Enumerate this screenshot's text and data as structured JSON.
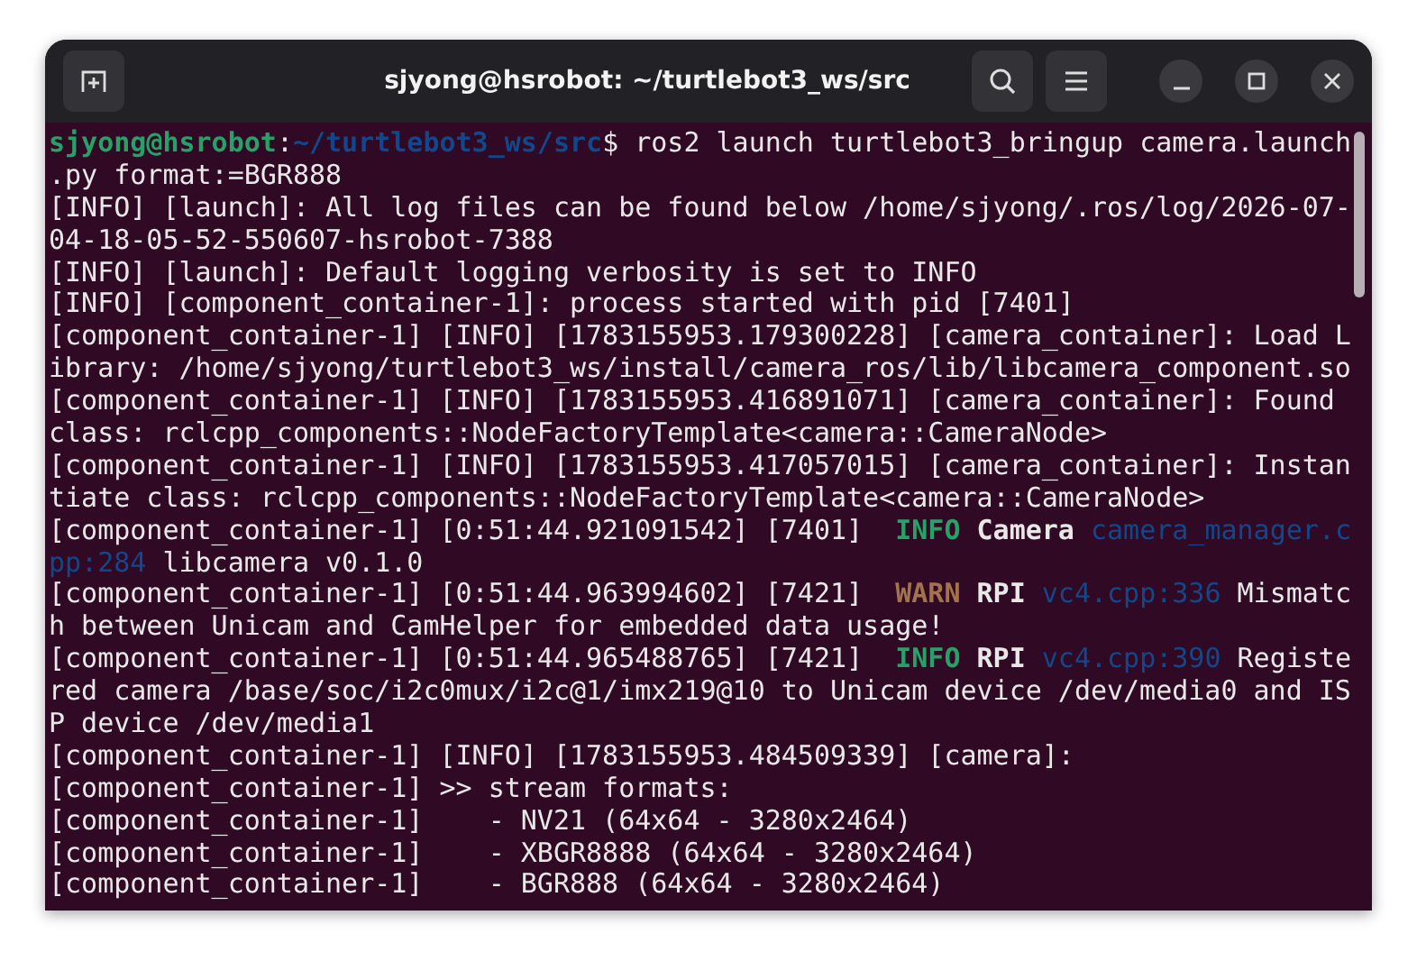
{
  "window": {
    "title": "sjyong@hsrobot: ~/turtlebot3_ws/src"
  },
  "terminal": {
    "lines": [
      {
        "segments": [
          {
            "kind": "user",
            "text": "sjyong@hsrobot"
          },
          {
            "kind": "plain",
            "text": ":"
          },
          {
            "kind": "path",
            "text": "~/turtlebot3_ws/src"
          },
          {
            "kind": "plain",
            "text": "$ ros2 launch turtlebot3_bringup camera.launch"
          }
        ]
      },
      {
        "segments": [
          {
            "kind": "plain",
            "text": ".py format:=BGR888"
          }
        ]
      },
      {
        "segments": [
          {
            "kind": "plain",
            "text": "[INFO] [launch]: All log files can be found below /home/sjyong/.ros/log/2026-07-"
          }
        ]
      },
      {
        "segments": [
          {
            "kind": "plain",
            "text": "04-18-05-52-550607-hsrobot-7388"
          }
        ]
      },
      {
        "segments": [
          {
            "kind": "plain",
            "text": "[INFO] [launch]: Default logging verbosity is set to INFO"
          }
        ]
      },
      {
        "segments": [
          {
            "kind": "plain",
            "text": "[INFO] [component_container-1]: process started with pid [7401]"
          }
        ]
      },
      {
        "segments": [
          {
            "kind": "plain",
            "text": "[component_container-1] [INFO] [1783155953.179300228] [camera_container]: Load L"
          }
        ]
      },
      {
        "segments": [
          {
            "kind": "plain",
            "text": "ibrary: /home/sjyong/turtlebot3_ws/install/camera_ros/lib/libcamera_component.so"
          }
        ]
      },
      {
        "segments": [
          {
            "kind": "plain",
            "text": "[component_container-1] [INFO] [1783155953.416891071] [camera_container]: Found "
          }
        ]
      },
      {
        "segments": [
          {
            "kind": "plain",
            "text": "class: rclcpp_components::NodeFactoryTemplate<camera::CameraNode>"
          }
        ]
      },
      {
        "segments": [
          {
            "kind": "plain",
            "text": "[component_container-1] [INFO] [1783155953.417057015] [camera_container]: Instan"
          }
        ]
      },
      {
        "segments": [
          {
            "kind": "plain",
            "text": "tiate class: rclcpp_components::NodeFactoryTemplate<camera::CameraNode>"
          }
        ]
      },
      {
        "segments": [
          {
            "kind": "plain",
            "text": "[component_container-1] [0:51:44.921091542] [7401]  "
          },
          {
            "kind": "info",
            "text": "INFO "
          },
          {
            "kind": "bold",
            "text": "Camera "
          },
          {
            "kind": "source",
            "text": "camera_manager.c"
          }
        ]
      },
      {
        "segments": [
          {
            "kind": "source",
            "text": "pp:284"
          },
          {
            "kind": "plain",
            "text": " libcamera v0.1.0"
          }
        ]
      },
      {
        "segments": [
          {
            "kind": "plain",
            "text": "[component_container-1] [0:51:44.963994602] [7421]  "
          },
          {
            "kind": "warn",
            "text": "WARN "
          },
          {
            "kind": "bold",
            "text": "RPI "
          },
          {
            "kind": "source",
            "text": "vc4.cpp:336"
          },
          {
            "kind": "plain",
            "text": " Mismatc"
          }
        ]
      },
      {
        "segments": [
          {
            "kind": "plain",
            "text": "h between Unicam and CamHelper for embedded data usage!"
          }
        ]
      },
      {
        "segments": [
          {
            "kind": "plain",
            "text": "[component_container-1] [0:51:44.965488765] [7421]  "
          },
          {
            "kind": "info",
            "text": "INFO "
          },
          {
            "kind": "bold",
            "text": "RPI "
          },
          {
            "kind": "source",
            "text": "vc4.cpp:390"
          },
          {
            "kind": "plain",
            "text": " Registe"
          }
        ]
      },
      {
        "segments": [
          {
            "kind": "plain",
            "text": "red camera /base/soc/i2c0mux/i2c@1/imx219@10 to Unicam device /dev/media0 and IS"
          }
        ]
      },
      {
        "segments": [
          {
            "kind": "plain",
            "text": "P device /dev/media1"
          }
        ]
      },
      {
        "segments": [
          {
            "kind": "plain",
            "text": "[component_container-1] [INFO] [1783155953.484509339] [camera]:"
          }
        ]
      },
      {
        "segments": [
          {
            "kind": "plain",
            "text": "[component_container-1] >> stream formats:"
          }
        ]
      },
      {
        "segments": [
          {
            "kind": "plain",
            "text": "[component_container-1]    - NV21 (64x64 - 3280x2464)"
          }
        ]
      },
      {
        "segments": [
          {
            "kind": "plain",
            "text": "[component_container-1]    - XBGR8888 (64x64 - 3280x2464)"
          }
        ]
      },
      {
        "segments": [
          {
            "kind": "plain",
            "text": "[component_container-1]    - BGR888 (64x64 - 3280x2464)"
          }
        ]
      }
    ]
  }
}
